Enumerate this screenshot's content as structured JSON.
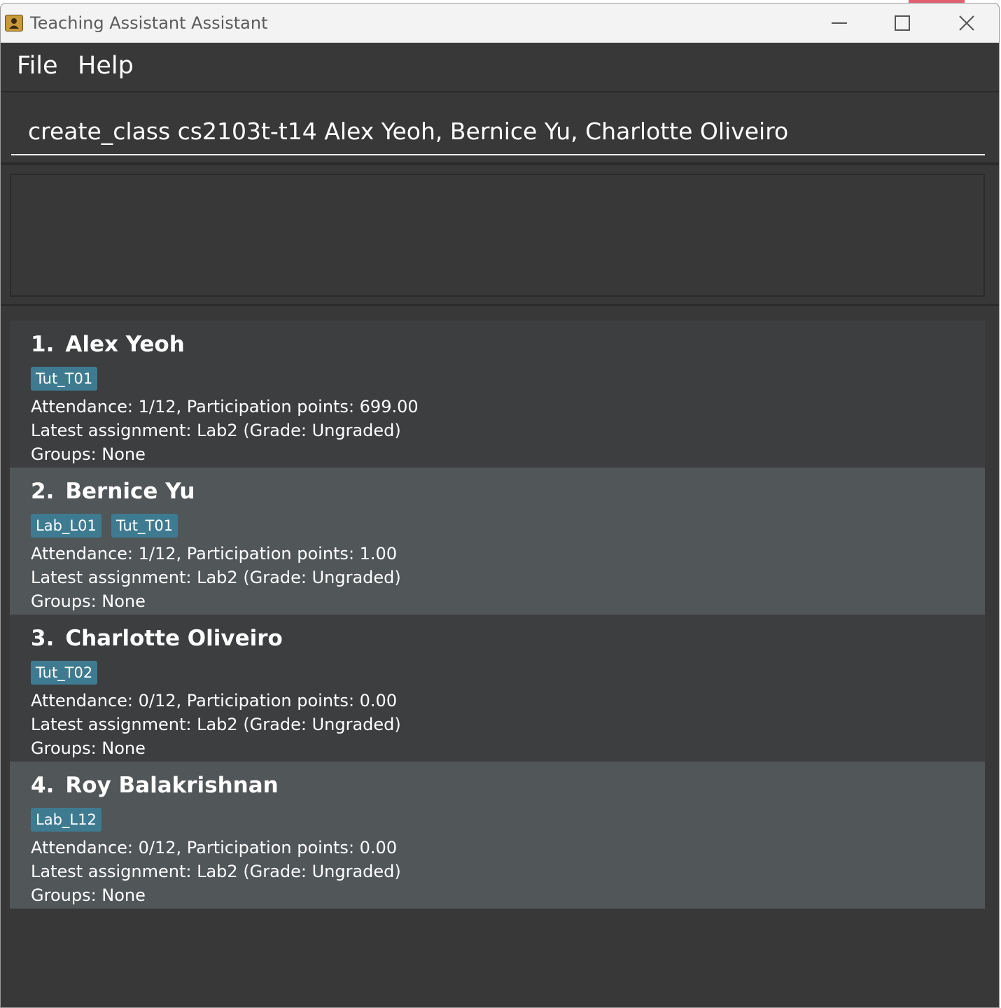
{
  "window": {
    "title": "Teaching Assistant Assistant",
    "app_icon": "address-book-icon",
    "controls": [
      "minimize-icon",
      "maximize-icon",
      "close-icon"
    ]
  },
  "menu": {
    "file": "File",
    "help": "Help"
  },
  "command_box": {
    "value": "create_class cs2103t-t14 Alex Yeoh, Bernice Yu, Charlotte Oliveiro"
  },
  "result_display": {
    "text": ""
  },
  "colors": {
    "background": "#383838",
    "card_odd": "#3c3e3f",
    "card_even": "#515658",
    "tag": "#3e7b91",
    "text": "#ffffff"
  },
  "persons": [
    {
      "index": "1.",
      "name": "Alex Yeoh",
      "tags": [
        "Tut_T01"
      ],
      "attendance": "Attendance: 1/12, Participation points: 699.00",
      "assignment": "Latest assignment: Lab2 (Grade: Ungraded)",
      "groups": "Groups: None"
    },
    {
      "index": "2.",
      "name": "Bernice Yu",
      "tags": [
        "Lab_L01",
        "Tut_T01"
      ],
      "attendance": "Attendance: 1/12, Participation points: 1.00",
      "assignment": "Latest assignment: Lab2 (Grade: Ungraded)",
      "groups": "Groups: None"
    },
    {
      "index": "3.",
      "name": "Charlotte Oliveiro",
      "tags": [
        "Tut_T02"
      ],
      "attendance": "Attendance: 0/12, Participation points: 0.00",
      "assignment": "Latest assignment: Lab2 (Grade: Ungraded)",
      "groups": "Groups: None"
    },
    {
      "index": "4.",
      "name": "Roy Balakrishnan",
      "tags": [
        "Lab_L12"
      ],
      "attendance": "Attendance: 0/12, Participation points: 0.00",
      "assignment": "Latest assignment: Lab2 (Grade: Ungraded)",
      "groups": "Groups: None"
    }
  ]
}
